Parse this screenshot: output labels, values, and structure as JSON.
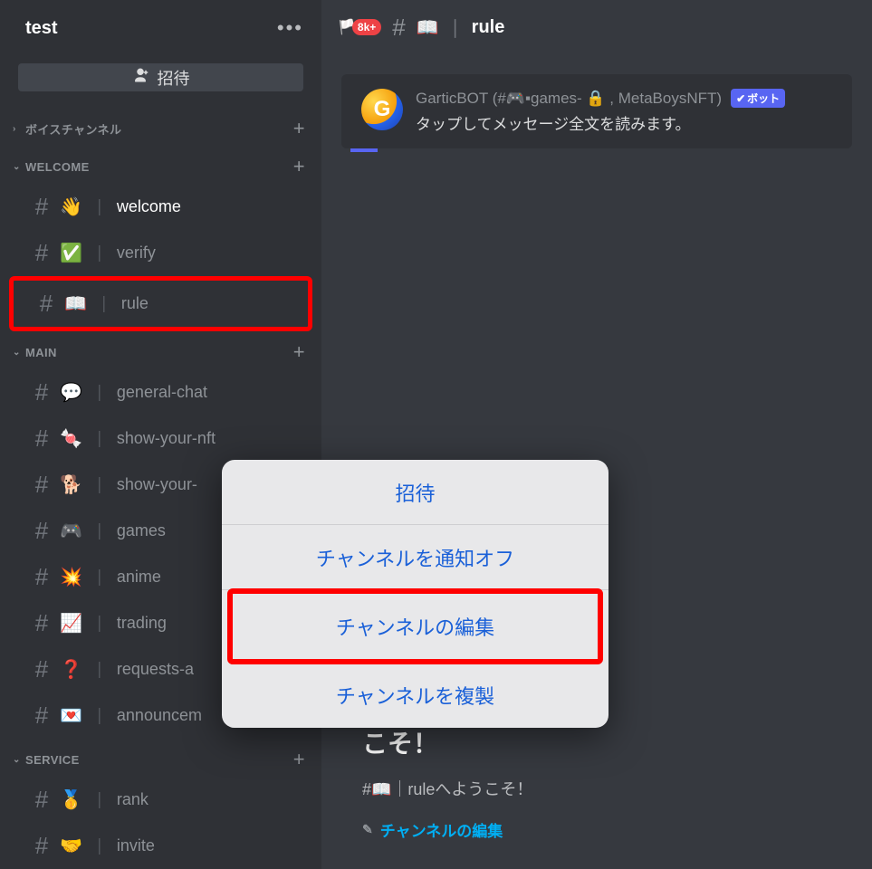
{
  "server": {
    "name": "test",
    "invite_button": "招待"
  },
  "categories": {
    "voice": "ボイスチャンネル",
    "welcome": "WELCOME",
    "main": "MAIN",
    "service": "SERVICE"
  },
  "channels": {
    "welcome": [
      {
        "emoji": "👋",
        "name": "welcome"
      },
      {
        "emoji": "✅",
        "name": "verify"
      },
      {
        "emoji": "📖",
        "name": "rule"
      }
    ],
    "main": [
      {
        "emoji": "💬",
        "name": "general-chat"
      },
      {
        "emoji": "🍬",
        "name": "show-your-nft"
      },
      {
        "emoji": "🐕",
        "name": "show-your-"
      },
      {
        "emoji": "🎮",
        "name": "games"
      },
      {
        "emoji": "💥",
        "name": "anime"
      },
      {
        "emoji": "📈",
        "name": "trading"
      },
      {
        "emoji": "❓",
        "name": "requests-a"
      },
      {
        "emoji": "💌",
        "name": "announcem"
      }
    ],
    "service": [
      {
        "emoji": "🥇",
        "name": "rank"
      },
      {
        "emoji": "🤝",
        "name": "invite"
      }
    ]
  },
  "header": {
    "badge": "8k+",
    "channel_emoji": "📖",
    "channel_name": "rule"
  },
  "reply": {
    "author": "GarticBOT (#🎮▪games- 🔒 , MetaBoysNFT)",
    "bot_label": "ボット",
    "subtitle": "タップしてメッセージ全文を読みます。"
  },
  "welcome_block": {
    "title_suffix": "こそ！",
    "subtitle": "#📖｜ruleへようこそ！",
    "edit": "チャンネルの編集"
  },
  "context_menu": {
    "items": [
      "招待",
      "チャンネルを通知オフ",
      "チャンネルの編集",
      "チャンネルを複製"
    ]
  }
}
